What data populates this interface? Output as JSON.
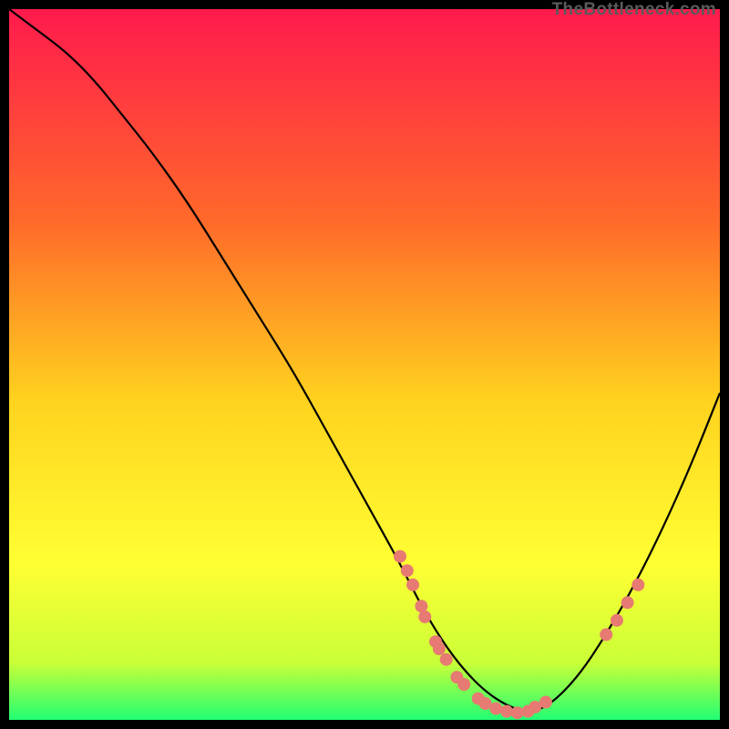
{
  "watermark": "TheBottleneck.com",
  "chart_data": {
    "type": "line",
    "title": "",
    "xlabel": "",
    "ylabel": "",
    "xlim": [
      0,
      100
    ],
    "ylim": [
      0,
      100
    ],
    "gradient_stops": [
      {
        "offset": 0,
        "color": "#ff1a4d"
      },
      {
        "offset": 30,
        "color": "#ff6a2a"
      },
      {
        "offset": 55,
        "color": "#ffd21e"
      },
      {
        "offset": 78,
        "color": "#ffff33"
      },
      {
        "offset": 92,
        "color": "#c9ff37"
      },
      {
        "offset": 100,
        "color": "#21ff73"
      }
    ],
    "series": [
      {
        "name": "bottleneck-curve",
        "x": [
          0,
          4,
          8,
          12,
          16,
          20,
          25,
          30,
          35,
          40,
          45,
          50,
          55,
          58,
          61,
          64,
          67,
          70,
          73,
          76,
          80,
          84,
          88,
          92,
          96,
          100
        ],
        "y": [
          100,
          97,
          94,
          90,
          85,
          80,
          73,
          65,
          57,
          49,
          40,
          31,
          22,
          16,
          11,
          7,
          4,
          2,
          1,
          2,
          6,
          12,
          19,
          27,
          36,
          46
        ]
      }
    ],
    "markers": {
      "name": "data-dots",
      "color": "#e77a72",
      "radius": 7,
      "points": [
        {
          "x": 55,
          "y": 23
        },
        {
          "x": 56,
          "y": 21
        },
        {
          "x": 56.8,
          "y": 19
        },
        {
          "x": 58,
          "y": 16
        },
        {
          "x": 58.5,
          "y": 14.5
        },
        {
          "x": 60,
          "y": 11
        },
        {
          "x": 60.5,
          "y": 10
        },
        {
          "x": 61.5,
          "y": 8.5
        },
        {
          "x": 63,
          "y": 6
        },
        {
          "x": 64,
          "y": 5
        },
        {
          "x": 66,
          "y": 3
        },
        {
          "x": 67,
          "y": 2.3
        },
        {
          "x": 68.5,
          "y": 1.6
        },
        {
          "x": 70,
          "y": 1.2
        },
        {
          "x": 71.5,
          "y": 1.0
        },
        {
          "x": 73,
          "y": 1.2
        },
        {
          "x": 74,
          "y": 1.8
        },
        {
          "x": 75.5,
          "y": 2.5
        },
        {
          "x": 84,
          "y": 12
        },
        {
          "x": 85.5,
          "y": 14
        },
        {
          "x": 87,
          "y": 16.5
        },
        {
          "x": 88.5,
          "y": 19
        }
      ]
    }
  }
}
